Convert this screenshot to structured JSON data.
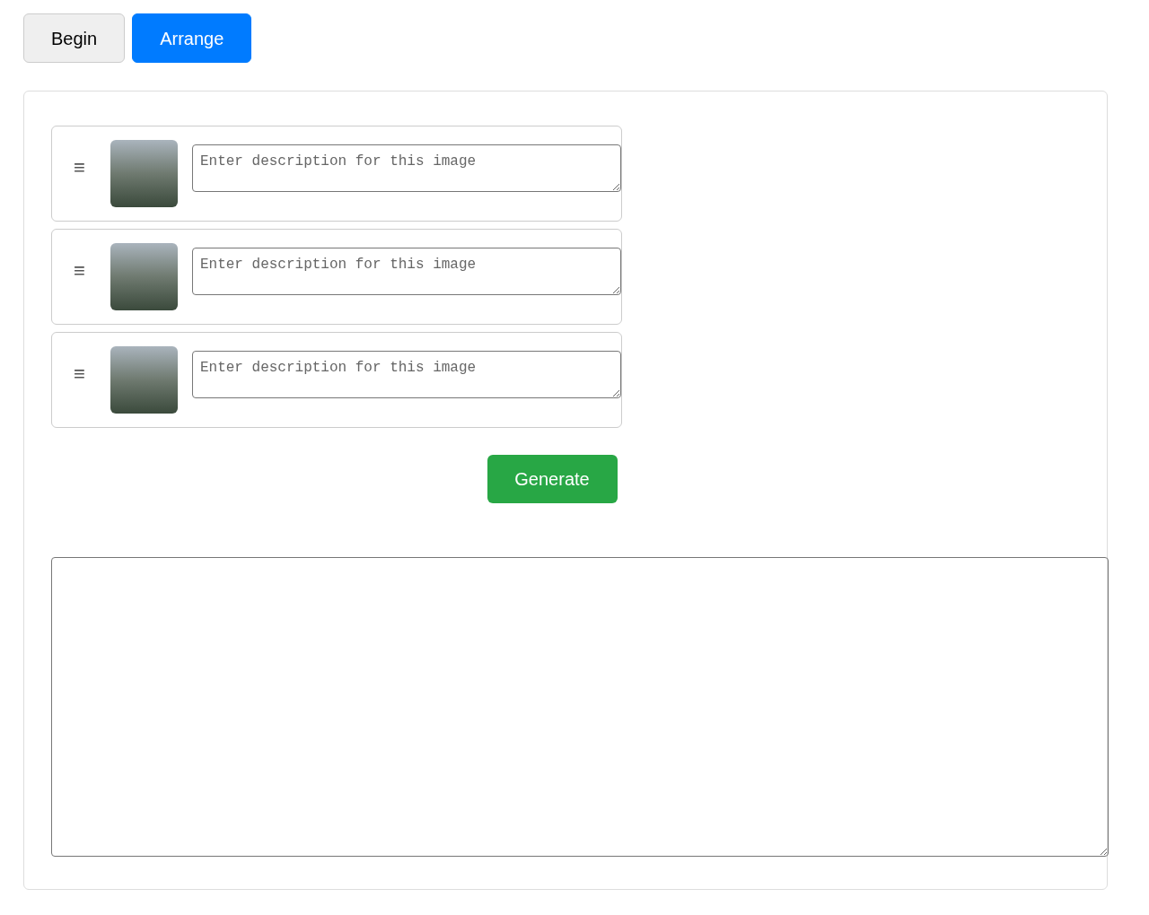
{
  "tabs": [
    {
      "label": "Begin",
      "selected": false
    },
    {
      "label": "Arrange",
      "selected": true
    }
  ],
  "images": [
    {
      "handle": "≡",
      "description": {
        "placeholder": "Enter description for this image"
      }
    },
    {
      "handle": "≡",
      "description": {
        "placeholder": "Enter description for this image"
      }
    },
    {
      "handle": "≡",
      "description": {
        "placeholder": "Enter description for this image"
      }
    }
  ],
  "generate_button": "Generate"
}
